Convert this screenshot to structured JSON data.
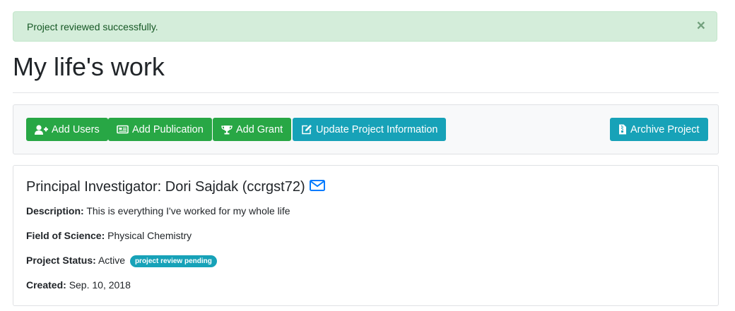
{
  "alert": {
    "message": "Project reviewed successfully.",
    "close_label": "×"
  },
  "page": {
    "title": "My life's work"
  },
  "toolbar": {
    "add_users": "Add Users",
    "add_publication": "Add Publication",
    "add_grant": "Add Grant",
    "update_project": "Update Project Information",
    "archive_project": "Archive Project"
  },
  "project": {
    "pi_heading": "Principal Investigator: Dori Sajdak (ccrgst72)",
    "description_label": "Description:",
    "description": "This is everything I've worked for my whole life",
    "field_label": "Field of Science:",
    "field": "Physical Chemistry",
    "status_label": "Project Status:",
    "status": "Active",
    "status_badge": "project review pending",
    "created_label": "Created:",
    "created": "Sep. 10, 2018"
  },
  "colors": {
    "success": "#28a745",
    "info": "#17a2b8",
    "alert_bg": "#d4edda",
    "link": "#007bff"
  },
  "icons": {
    "add_users": "user-plus-icon",
    "add_publication": "newspaper-icon",
    "add_grant": "trophy-icon",
    "update_project": "edit-icon",
    "archive_project": "file-archive-icon",
    "pi_email": "envelope-icon"
  }
}
